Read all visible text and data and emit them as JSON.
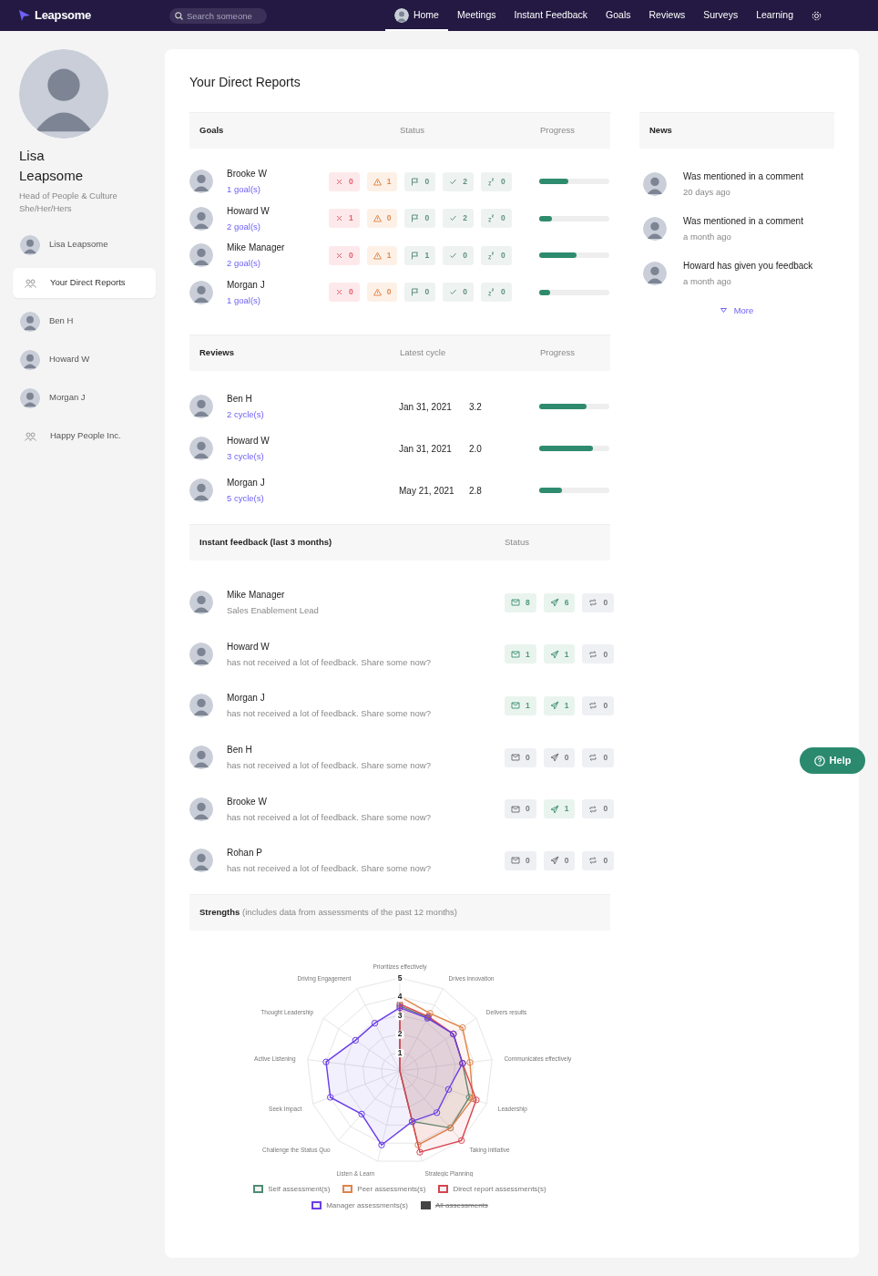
{
  "navbar": {
    "logo": "Leapsome",
    "search": {
      "placeholder": "Search someone"
    },
    "items": [
      {
        "label": "Home",
        "selected": true,
        "kind": "avatar"
      },
      {
        "label": "Meetings",
        "selected": false
      },
      {
        "label": "Instant Feedback",
        "selected": false
      },
      {
        "label": "Goals",
        "selected": false
      },
      {
        "label": "Reviews",
        "selected": false
      },
      {
        "label": "Surveys",
        "selected": false
      },
      {
        "label": "Learning",
        "selected": false
      }
    ]
  },
  "profile": {
    "name": "Lisa Leapsome",
    "role": "Head of People & Culture",
    "pronouns": "She/Her/Hers"
  },
  "sidebar": {
    "items": [
      {
        "label": "Lisa Leapsome",
        "kind": "person",
        "selected": false
      },
      {
        "label": "Your Direct Reports",
        "kind": "group",
        "selected": true
      },
      {
        "label": "Ben H",
        "kind": "person",
        "selected": false
      },
      {
        "label": "Howard W",
        "kind": "person",
        "selected": false
      },
      {
        "label": "Morgan J",
        "kind": "person",
        "selected": false
      },
      {
        "label": "Happy People Inc.",
        "kind": "group",
        "selected": false
      }
    ]
  },
  "title": "Your Direct Reports",
  "goals": {
    "columns": [
      "Goals",
      "Status",
      "Progress"
    ],
    "rows": [
      {
        "name": "Brooke W",
        "link": "1 goal(s)",
        "level": 0.42,
        "status": [
          {
            "kind": "failed",
            "count": "0"
          },
          {
            "kind": "at_risk",
            "count": "1"
          },
          {
            "kind": "flagged",
            "count": "0"
          },
          {
            "kind": "done",
            "count": "2"
          },
          {
            "kind": "paused",
            "count": "0"
          }
        ]
      },
      {
        "name": "Howard W",
        "link": "2 goal(s)",
        "level": 0.18,
        "status": [
          {
            "kind": "failed",
            "count": "1"
          },
          {
            "kind": "at_risk",
            "count": "0"
          },
          {
            "kind": "flagged",
            "count": "0"
          },
          {
            "kind": "done",
            "count": "2"
          },
          {
            "kind": "paused",
            "count": "0"
          }
        ]
      },
      {
        "name": "Mike Manager",
        "link": "2 goal(s)",
        "level": 0.53,
        "status": [
          {
            "kind": "failed",
            "count": "0"
          },
          {
            "kind": "at_risk",
            "count": "1"
          },
          {
            "kind": "flagged",
            "count": "1"
          },
          {
            "kind": "done",
            "count": "0"
          },
          {
            "kind": "paused",
            "count": "0"
          }
        ]
      },
      {
        "name": "Morgan J",
        "link": "1 goal(s)",
        "level": 0.16,
        "status": [
          {
            "kind": "failed",
            "count": "0"
          },
          {
            "kind": "at_risk",
            "count": "0"
          },
          {
            "kind": "flagged",
            "count": "0"
          },
          {
            "kind": "done",
            "count": "0"
          },
          {
            "kind": "paused",
            "count": "0"
          }
        ]
      }
    ]
  },
  "reviews": {
    "columns": [
      "Reviews",
      "Latest cycle",
      "Progress"
    ],
    "rows": [
      {
        "name": "Ben H",
        "link": "2 cycle(s)",
        "date": "Jan 31, 2021",
        "score": "3.2",
        "level": 0.68
      },
      {
        "name": "Howard W",
        "link": "3 cycle(s)",
        "date": "Jan 31, 2021",
        "score": "2.0",
        "level": 0.76
      },
      {
        "name": "Morgan J",
        "link": "5 cycle(s)",
        "date": "May 21, 2021",
        "score": "2.8",
        "level": 0.33
      }
    ]
  },
  "instant_feedback": {
    "columns": [
      "Instant feedback (last 3 months)",
      "Status"
    ],
    "rows": [
      {
        "name": "Mike Manager",
        "text": "Sales Enablement Lead",
        "received": "8",
        "given": "6",
        "requested": "0"
      },
      {
        "name": "Howard W",
        "text": "has not received a lot of feedback. Share some now?",
        "received": "1",
        "given": "1",
        "requested": "0"
      },
      {
        "name": "Morgan J",
        "text": "has not received a lot of feedback. Share some now?",
        "received": "1",
        "given": "1",
        "requested": "0"
      },
      {
        "name": "Ben H",
        "text": "has not received a lot of feedback. Share some now?",
        "received": "0",
        "given": "0",
        "requested": "0"
      },
      {
        "name": "Brooke W",
        "text": "has not received a lot of feedback. Share some now?",
        "received": "0",
        "given": "1",
        "requested": "0"
      },
      {
        "name": "Rohan P",
        "text": "has not received a lot of feedback. Share some now?",
        "received": "0",
        "given": "0",
        "requested": "0"
      }
    ]
  },
  "strengths": {
    "header": "**Strengths** (includes data from assessments of the past 12 months)",
    "radar": {
      "axes_right": [
        "Prioritizes effectively",
        "Drives innovation",
        "Delivers results",
        "Communicates effectively",
        "Leadership",
        "Taking initiative",
        "Strategic Planning"
      ],
      "axes_left": [
        "Driving Engagement",
        "Thought Leadership",
        "Active Listening",
        "Seek Impact",
        "Challenge the Status Quo",
        "Listen & Learn"
      ],
      "scale": [
        "5",
        "4",
        "3",
        "2",
        "1"
      ],
      "legend": [
        {
          "name": "Self assessment(s)",
          "color": "#4e8c73",
          "hidden": false
        },
        {
          "name": "Peer assessments(s)",
          "color": "#e0844a",
          "hidden": false
        },
        {
          "name": "Direct report assessments(s)",
          "color": "#d64550",
          "hidden": false
        },
        {
          "name": "Manager assessments(s)",
          "color": "#6a3de8",
          "hidden": false
        },
        {
          "name": "All assessments",
          "color": "#444444",
          "hidden": true
        }
      ]
    }
  },
  "news": {
    "header": "News",
    "items": [
      {
        "text": "Was mentioned in a comment",
        "time": "20 days ago"
      },
      {
        "text": "Was mentioned in a comment",
        "time": "a month ago"
      },
      {
        "text": "Howard has given you feedback",
        "time": "a month ago"
      }
    ],
    "more": "More"
  },
  "help": "Help"
}
